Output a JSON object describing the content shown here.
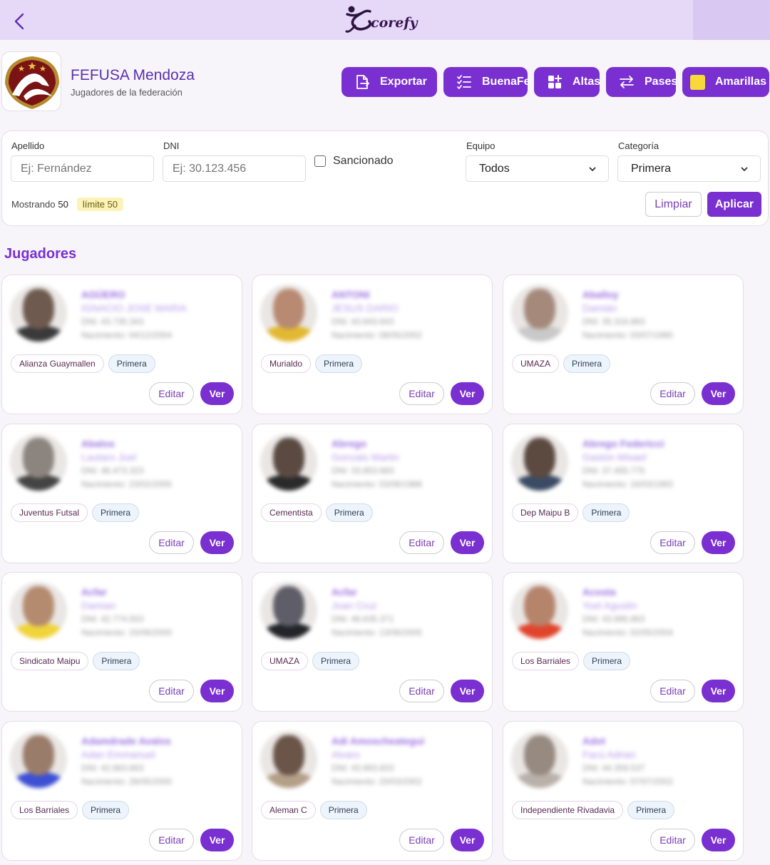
{
  "app": {
    "logo_text": "corefy"
  },
  "org": {
    "name": "FEFUSA Mendoza",
    "subtitle": "Jugadores de la federación"
  },
  "actions": [
    {
      "label": "Exportar",
      "icon": "export-file-icon"
    },
    {
      "label": "BuenaFe",
      "icon": "checklist-icon"
    },
    {
      "label": "Altas",
      "icon": "grid-plus-icon"
    },
    {
      "label": "Pases",
      "icon": "transfer-arrows-icon"
    },
    {
      "label": "Amarillas",
      "icon": "yellow-card-icon",
      "color": "#f7d93a"
    }
  ],
  "filters": {
    "surname": {
      "label": "Apellido",
      "placeholder": "Ej: Fernández"
    },
    "dni": {
      "label": "DNI",
      "placeholder": "Ej: 30.123.456"
    },
    "sanctioned": {
      "label": "Sancionado",
      "checked": false
    },
    "team": {
      "label": "Equipo",
      "value": "Todos"
    },
    "category": {
      "label": "Categoría",
      "value": "Primera"
    },
    "showing_label": "Mostrando",
    "showing_count": "50",
    "limit_label": "límite 50",
    "clear_label": "Limpiar",
    "apply_label": "Aplicar"
  },
  "section_title": "Jugadores",
  "card_buttons": {
    "edit": "Editar",
    "view": "Ver"
  },
  "players": [
    {
      "surname": "AGÜERO",
      "name": "IGNACIO JOSE MARIA",
      "dni": "DNI: 43.735.343",
      "dob": "Nacimiento: 04/12/2004",
      "team": "Alianza Guaymallen",
      "category": "Primera"
    },
    {
      "surname": "ANTONI",
      "name": "JESUS DARIO",
      "dni": "DNI: 43.843.643",
      "dob": "Nacimiento: 08/05/2002",
      "team": "Murialdo",
      "category": "Primera"
    },
    {
      "surname": "Aballoy",
      "name": "Damián",
      "dni": "DNI: 35.316.883",
      "dob": "Nacimiento: 03/07/1990",
      "team": "UMAZA",
      "category": "Primera"
    },
    {
      "surname": "Abalos",
      "name": "Lautaro Joel",
      "dni": "DNI: 46.473.323",
      "dob": "Nacimiento: 23/02/2005",
      "team": "Juventus Futsal",
      "category": "Primera"
    },
    {
      "surname": "Abrego",
      "name": "Gonzalo Martin",
      "dni": "DNI: 33.853.683",
      "dob": "Nacimiento: 03/06/1988",
      "team": "Cementista",
      "category": "Primera"
    },
    {
      "surname": "Abrego Federicci",
      "name": "Gastón Misael",
      "dni": "DNI: 37.455.775",
      "dob": "Nacimiento: 16/03/1993",
      "team": "Dep Maipu B",
      "category": "Primera"
    },
    {
      "surname": "Acfar",
      "name": "Damian",
      "dni": "DNI: 42.774.553",
      "dob": "Nacimiento: 15/06/2000",
      "team": "Sindicato Maipu",
      "category": "Primera"
    },
    {
      "surname": "Acfar",
      "name": "Joan Cruz",
      "dni": "DNI: 46.635.371",
      "dob": "Nacimiento: 13/06/2005",
      "team": "UMAZA",
      "category": "Primera"
    },
    {
      "surname": "Acosta",
      "name": "Yoel Agustin",
      "dni": "DNI: 43.995.863",
      "dob": "Nacimiento: 02/05/2004",
      "team": "Los Barriales",
      "category": "Primera"
    },
    {
      "surname": "Adamdrade Avalos",
      "name": "Adan Emmanuel",
      "dni": "DNI: 42.863.663",
      "dob": "Nacimiento: 26/05/2000",
      "team": "Los Barriales",
      "category": "Primera"
    },
    {
      "surname": "Adi Amoscheategui",
      "name": "Alvaro",
      "dni": "DNI: 43.993.833",
      "dob": "Nacimiento: 20/03/2002",
      "team": "Aleman C",
      "category": "Primera"
    },
    {
      "surname": "Adot",
      "name": "Facú Adrian",
      "dni": "DNI: 44.359.537",
      "dob": "Nacimiento: 07/07/2002",
      "team": "Independiente Rivadavia",
      "category": "Primera"
    }
  ],
  "avatar_colors": [
    {
      "skin": "#6e5a4e",
      "shirt": "#3a3a3a"
    },
    {
      "skin": "#b98a72",
      "shirt": "#e2b833"
    },
    {
      "skin": "#a58a7c",
      "shirt": "#c9c9c9"
    },
    {
      "skin": "#8c847e",
      "shirt": "#444"
    },
    {
      "skin": "#5a4a42",
      "shirt": "#2a2a2a"
    },
    {
      "skin": "#5c4a40",
      "shirt": "#3b4b63"
    },
    {
      "skin": "#b58b6f",
      "shirt": "#f0d43c"
    },
    {
      "skin": "#5f5e68",
      "shirt": "#23232a"
    },
    {
      "skin": "#b6846b",
      "shirt": "#e0452c"
    },
    {
      "skin": "#9a7c6a",
      "shirt": "#3d4fd4"
    },
    {
      "skin": "#6a5548",
      "shirt": "#b49f88"
    },
    {
      "skin": "#978a80",
      "shirt": "#b9b1a9"
    }
  ]
}
